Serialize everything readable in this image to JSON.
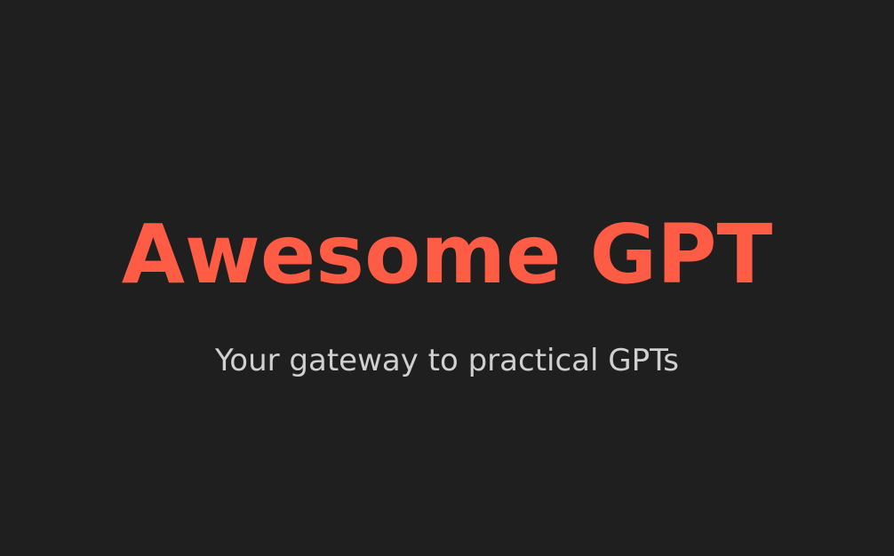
{
  "hero": {
    "title": "Awesome GPT",
    "subtitle": "Your gateway to practical GPTs"
  },
  "colors": {
    "background": "#1f1f1f",
    "title": "#ff5c45",
    "subtitle": "#d0d0d0"
  }
}
